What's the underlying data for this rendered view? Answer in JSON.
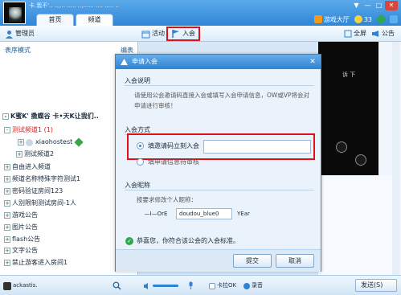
{
  "window": {
    "title": "卡.我不'.. ..,...  ..... ..,...... .... .....  ..",
    "tabs": [
      "首页",
      "频道"
    ],
    "game_hall_label": "游戏大厅",
    "coins": "33",
    "controls": [
      "▼",
      "—",
      "□",
      "✕"
    ]
  },
  "toolbar": {
    "admin_label": "管理员",
    "activity_label": "活动",
    "join_label": "入会",
    "fullscreen_label": "全屏",
    "announce_label": "公告"
  },
  "left": {
    "mode_label": "表序模式",
    "mode_edit": "编表",
    "tree": [
      {
        "label": "K蜜K' 擞蝶谷 卡•天K让我们..",
        "type": "bigname"
      },
      {
        "label": "测试频道1 (1)",
        "type": "channel"
      },
      {
        "label": "xiaohostest",
        "type": "user"
      },
      {
        "label": "测试频道2",
        "type": "sub"
      },
      {
        "label": "自由进入频道",
        "type": "room"
      },
      {
        "label": "频道名称特殊字符测试1",
        "type": "room"
      },
      {
        "label": "密码验证房间123",
        "type": "room"
      },
      {
        "label": "人别限制测试房间-1人",
        "type": "room"
      },
      {
        "label": "游戏公告",
        "type": "room"
      },
      {
        "label": "图片公告",
        "type": "room"
      },
      {
        "label": "flash公告",
        "type": "room"
      },
      {
        "label": "文字公告",
        "type": "room"
      },
      {
        "label": "禁止游客进入房间1",
        "type": "room"
      }
    ]
  },
  "video": {
    "caption": "诉 下"
  },
  "dialog": {
    "title": "申请入会",
    "close": "✕",
    "section_desc": "入会说明",
    "desc_text": "请使用公会邀请码直接入会或填写入会申请信息，OW或VP将会对申请进行审核！",
    "section_method": "入会方式",
    "option1": "填邀请码立刻入会",
    "option2": "填申请信息待审核",
    "invite_code_value": "",
    "section_nick": "入会昵称",
    "nick_prompt": "按要求修改个人昵称：",
    "nick_prefix": "—I—OrE",
    "nick_value": "doudou_blue0",
    "nick_suffix": "YEar",
    "status_text": "恭喜您，你符合该公会的入会标准。",
    "submit_label": "提交",
    "cancel_label": "取消"
  },
  "bottom": {
    "name_label": "ackastis.",
    "mic_label": "卡拉OK",
    "record_label": "录音",
    "send_label": "发送(S)"
  },
  "colors": {
    "accent": "#2f82d3",
    "highlight": "#e0101a",
    "channel_red": "#d02020",
    "ok_green": "#2ea84a"
  }
}
